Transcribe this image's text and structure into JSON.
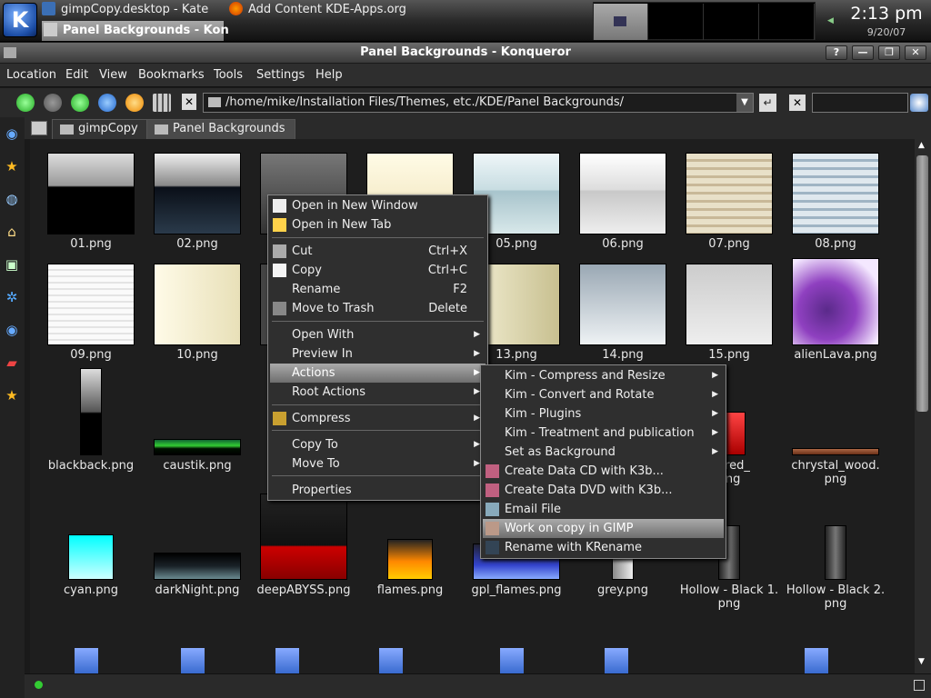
{
  "taskbar": {
    "tasks": [
      "gimpCopy.desktop - Kate",
      "Add Content KDE-Apps.org",
      "Panel Backgrounds - Kon"
    ],
    "time": "2:13 pm",
    "date": "9/20/07"
  },
  "window": {
    "title": "Panel Backgrounds - Konqueror",
    "buttons": [
      "?",
      "—",
      "❐",
      "✕"
    ]
  },
  "menubar": {
    "items": [
      "Location",
      "Edit",
      "View",
      "Bookmarks",
      "Tools",
      "Settings",
      "Help"
    ]
  },
  "location": {
    "url": "/home/mike/Installation Files/Themes, etc./KDE/Panel Backgrounds/"
  },
  "tabs": [
    "gimpCopy",
    "Panel Backgrounds"
  ],
  "files": [
    "01.png",
    "02.png",
    "",
    "",
    "05.png",
    "06.png",
    "07.png",
    "08.png",
    "09.png",
    "10.png",
    "",
    "",
    "13.png",
    "14.png",
    "15.png",
    "alienLava.png",
    "blackback.png",
    "caustik.png",
    "c",
    "",
    "",
    "",
    "al_red_",
    "chrystal_wood.",
    "cyan.png",
    "darkNight.png",
    "deepABYSS.png",
    "flames.png",
    "gpl_flames.png",
    "grey.png",
    "Hollow - Black 1.",
    "Hollow - Black 2."
  ],
  "file_second_lines": {
    "r3c7": "png",
    "r3c8": "png",
    "r4c7": "png",
    "r4c8": "png"
  },
  "context_menu": {
    "items": [
      {
        "label": "Open in New Window",
        "shortcut": "",
        "arrow": false
      },
      {
        "label": "Open in New Tab",
        "shortcut": "",
        "arrow": false
      },
      {
        "label": "Cut",
        "shortcut": "Ctrl+X",
        "arrow": false
      },
      {
        "label": "Copy",
        "shortcut": "Ctrl+C",
        "arrow": false
      },
      {
        "label": "Rename",
        "shortcut": "F2",
        "arrow": false
      },
      {
        "label": "Move to Trash",
        "shortcut": "Delete",
        "arrow": false
      },
      {
        "label": "Open With",
        "shortcut": "",
        "arrow": true
      },
      {
        "label": "Preview In",
        "shortcut": "",
        "arrow": true
      },
      {
        "label": "Actions",
        "shortcut": "",
        "arrow": true
      },
      {
        "label": "Root Actions",
        "shortcut": "",
        "arrow": true
      },
      {
        "label": "Compress",
        "shortcut": "",
        "arrow": true
      },
      {
        "label": "Copy To",
        "shortcut": "",
        "arrow": true
      },
      {
        "label": "Move To",
        "shortcut": "",
        "arrow": true
      },
      {
        "label": "Properties",
        "shortcut": "",
        "arrow": false
      }
    ]
  },
  "submenu": {
    "items": [
      "Kim - Compress and Resize",
      "Kim - Convert and Rotate",
      "Kim - Plugins",
      "Kim - Treatment and publication",
      "Set as Background",
      "Create Data CD with K3b...",
      "Create Data DVD with K3b...",
      "Email File",
      "Work on copy in GIMP",
      "Rename with KRename"
    ]
  },
  "colors": {
    "highlight": "#8a8a8a",
    "bg": "#1e1e1e"
  }
}
